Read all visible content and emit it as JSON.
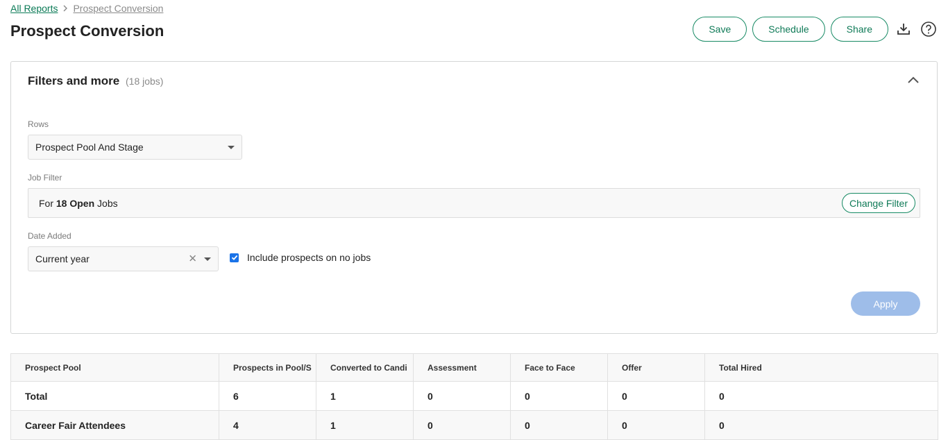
{
  "breadcrumb": {
    "parent": "All Reports",
    "current": "Prospect Conversion"
  },
  "page_title": "Prospect Conversion",
  "header_actions": {
    "save": "Save",
    "schedule": "Schedule",
    "share": "Share",
    "download_icon": "download-icon",
    "help_icon": "help-icon"
  },
  "filters": {
    "title": "Filters and more",
    "count": "(18 jobs)",
    "collapse_icon": "chevron-up-icon",
    "rows": {
      "label": "Rows",
      "value": "Prospect Pool And Stage"
    },
    "job_filter": {
      "label": "Job Filter",
      "prefix": "For",
      "emphasis": "18 Open",
      "suffix": "Jobs",
      "change_button": "Change Filter"
    },
    "date_added": {
      "label": "Date Added",
      "value": "Current year"
    },
    "include_no_jobs": {
      "label": "Include prospects on no jobs",
      "checked": true
    },
    "apply_button": "Apply"
  },
  "colors": {
    "accent": "#0f7a57",
    "apply_disabled": "#9ebde9",
    "checkbox": "#1a73e8"
  },
  "table": {
    "columns": [
      "Prospect Pool",
      "Prospects in Pool/S",
      "Converted to Candi",
      "Assessment",
      "Face to Face",
      "Offer",
      "Total Hired"
    ],
    "rows": [
      [
        "Total",
        "6",
        "1",
        "0",
        "0",
        "0",
        "0"
      ],
      [
        "Career Fair Attendees",
        "4",
        "1",
        "0",
        "0",
        "0",
        "0"
      ]
    ]
  }
}
